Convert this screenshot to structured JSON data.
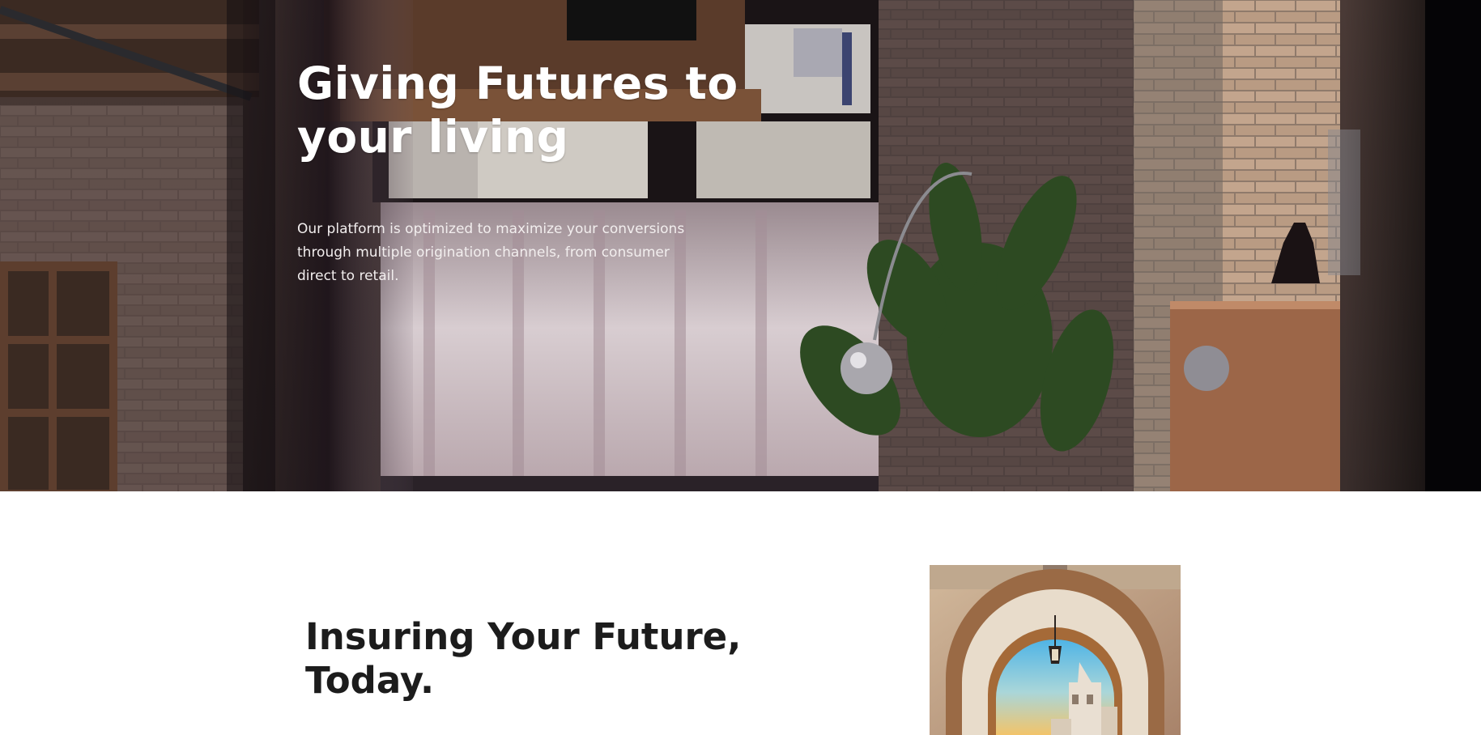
{
  "hero": {
    "title": "Giving Futures to your living",
    "description": "Our platform is optimized to maximize your conversions through multiple origination channels, from consumer direct to retail."
  },
  "section": {
    "title": "Insuring Your Future, Today."
  }
}
